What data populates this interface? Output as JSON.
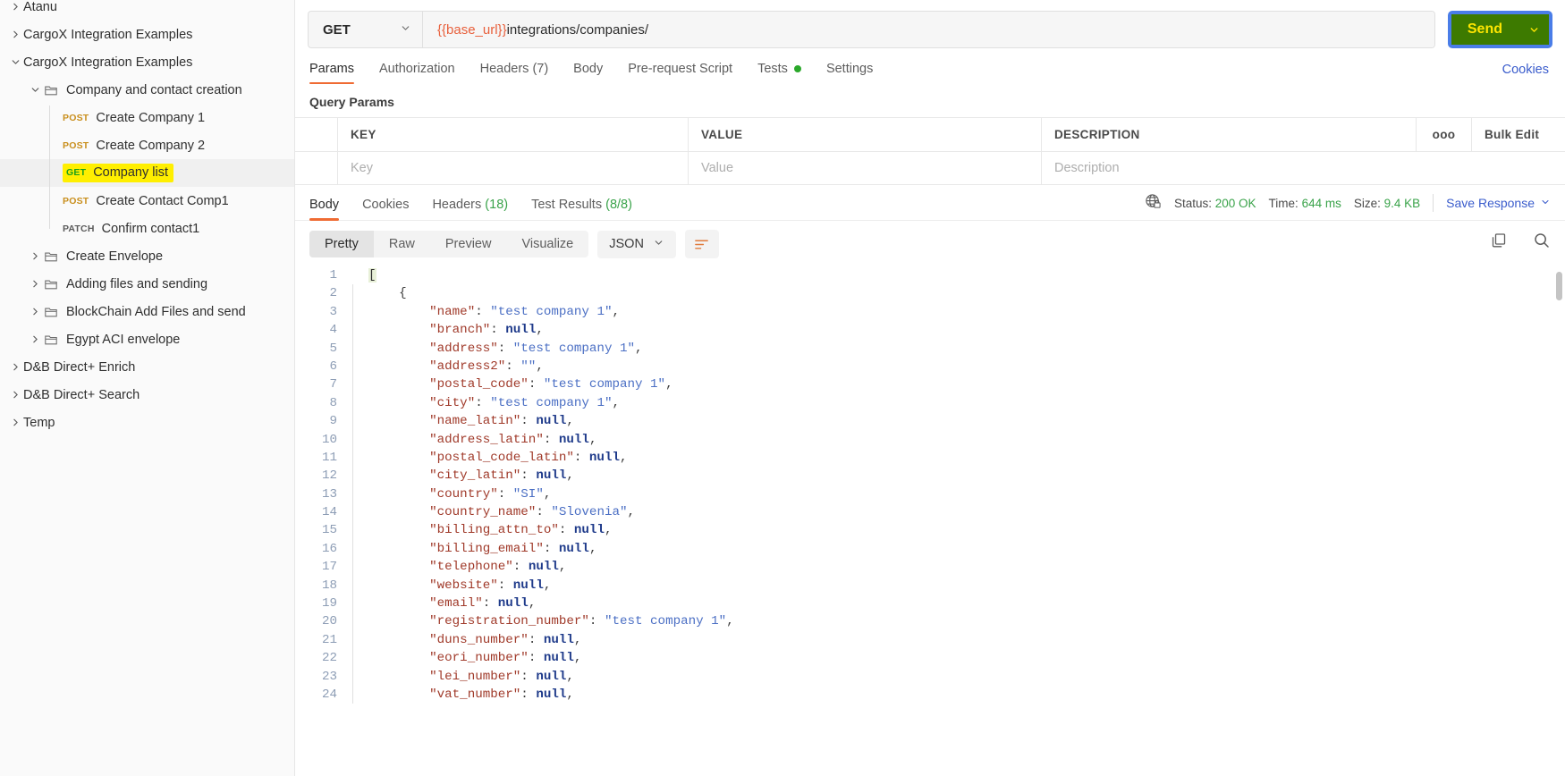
{
  "sidebar": {
    "items": [
      {
        "caret": "right",
        "indent": 0,
        "icon": "none",
        "label": "Atanu",
        "clipped": true
      },
      {
        "caret": "right",
        "indent": 0,
        "icon": "none",
        "label": "CargoX Integration Examples"
      },
      {
        "caret": "down",
        "indent": 0,
        "icon": "none",
        "label": "CargoX Integration Examples"
      },
      {
        "caret": "down",
        "indent": 1,
        "icon": "folder",
        "label": "Company and contact creation"
      },
      {
        "caret": "none",
        "indent": 2,
        "method": "POST",
        "label": "Create Company 1"
      },
      {
        "caret": "none",
        "indent": 2,
        "method": "POST",
        "label": "Create Company 2"
      },
      {
        "caret": "none",
        "indent": 2,
        "method": "GET",
        "label": "Company list",
        "selected": true,
        "highlight": true
      },
      {
        "caret": "none",
        "indent": 2,
        "method": "POST",
        "label": "Create Contact Comp1"
      },
      {
        "caret": "none",
        "indent": 2,
        "method": "PATCH",
        "label": "Confirm contact1"
      },
      {
        "caret": "right",
        "indent": 1,
        "icon": "folder",
        "label": "Create Envelope"
      },
      {
        "caret": "right",
        "indent": 1,
        "icon": "folder",
        "label": "Adding files and sending"
      },
      {
        "caret": "right",
        "indent": 1,
        "icon": "folder",
        "label": "BlockChain Add Files and send"
      },
      {
        "caret": "right",
        "indent": 1,
        "icon": "folder",
        "label": "Egypt ACI envelope"
      },
      {
        "caret": "right",
        "indent": 0,
        "icon": "none",
        "label": "D&B Direct+ Enrich"
      },
      {
        "caret": "right",
        "indent": 0,
        "icon": "none",
        "label": "D&B Direct+ Search"
      },
      {
        "caret": "right",
        "indent": 0,
        "icon": "none",
        "label": "Temp"
      }
    ]
  },
  "request": {
    "method": "GET",
    "url_variable": "{{base_url}}",
    "url_path": "integrations/companies/",
    "send_label": "Send",
    "cookies_label": "Cookies",
    "tabs": [
      {
        "label": "Params",
        "active": true
      },
      {
        "label": "Authorization",
        "active": false
      },
      {
        "label": "Headers (7)",
        "active": false
      },
      {
        "label": "Body",
        "active": false
      },
      {
        "label": "Pre-request Script",
        "active": false
      },
      {
        "label": "Tests",
        "active": false,
        "dot": true
      },
      {
        "label": "Settings",
        "active": false
      }
    ]
  },
  "query_params": {
    "title": "Query Params",
    "headers": [
      "KEY",
      "VALUE",
      "DESCRIPTION"
    ],
    "dots_label": "ooo",
    "bulk_edit_label": "Bulk Edit",
    "row_placeholders": [
      "Key",
      "Value",
      "Description"
    ]
  },
  "response": {
    "tabs": [
      {
        "label": "Body",
        "count": "",
        "active": true
      },
      {
        "label": "Cookies",
        "count": "",
        "active": false
      },
      {
        "label": "Headers",
        "count": "(18)",
        "active": false
      },
      {
        "label": "Test Results",
        "count": "(8/8)",
        "active": false
      }
    ],
    "status_label": "Status:",
    "status_value": "200 OK",
    "time_label": "Time:",
    "time_value": "644 ms",
    "size_label": "Size:",
    "size_value": "9.4 KB",
    "save_response_label": "Save Response",
    "view_modes": [
      {
        "label": "Pretty",
        "active": true
      },
      {
        "label": "Raw",
        "active": false
      },
      {
        "label": "Preview",
        "active": false
      },
      {
        "label": "Visualize",
        "active": false
      }
    ],
    "format": "JSON"
  },
  "body": {
    "lines": [
      {
        "n": 1,
        "indent": 0,
        "tokens": [
          {
            "t": "[",
            "c": "brk"
          }
        ]
      },
      {
        "n": 2,
        "indent": 1,
        "tokens": [
          {
            "t": "{",
            "c": "p"
          }
        ]
      },
      {
        "n": 3,
        "indent": 2,
        "tokens": [
          {
            "t": "\"name\"",
            "c": "k"
          },
          {
            "t": ": ",
            "c": "p"
          },
          {
            "t": "\"test company 1\"",
            "c": "s"
          },
          {
            "t": ",",
            "c": "p"
          }
        ]
      },
      {
        "n": 4,
        "indent": 2,
        "tokens": [
          {
            "t": "\"branch\"",
            "c": "k"
          },
          {
            "t": ": ",
            "c": "p"
          },
          {
            "t": "null",
            "c": "n"
          },
          {
            "t": ",",
            "c": "p"
          }
        ]
      },
      {
        "n": 5,
        "indent": 2,
        "tokens": [
          {
            "t": "\"address\"",
            "c": "k"
          },
          {
            "t": ": ",
            "c": "p"
          },
          {
            "t": "\"test company 1\"",
            "c": "s"
          },
          {
            "t": ",",
            "c": "p"
          }
        ]
      },
      {
        "n": 6,
        "indent": 2,
        "tokens": [
          {
            "t": "\"address2\"",
            "c": "k"
          },
          {
            "t": ": ",
            "c": "p"
          },
          {
            "t": "\"\"",
            "c": "s"
          },
          {
            "t": ",",
            "c": "p"
          }
        ]
      },
      {
        "n": 7,
        "indent": 2,
        "tokens": [
          {
            "t": "\"postal_code\"",
            "c": "k"
          },
          {
            "t": ": ",
            "c": "p"
          },
          {
            "t": "\"test company 1\"",
            "c": "s"
          },
          {
            "t": ",",
            "c": "p"
          }
        ]
      },
      {
        "n": 8,
        "indent": 2,
        "tokens": [
          {
            "t": "\"city\"",
            "c": "k"
          },
          {
            "t": ": ",
            "c": "p"
          },
          {
            "t": "\"test company 1\"",
            "c": "s"
          },
          {
            "t": ",",
            "c": "p"
          }
        ]
      },
      {
        "n": 9,
        "indent": 2,
        "tokens": [
          {
            "t": "\"name_latin\"",
            "c": "k"
          },
          {
            "t": ": ",
            "c": "p"
          },
          {
            "t": "null",
            "c": "n"
          },
          {
            "t": ",",
            "c": "p"
          }
        ]
      },
      {
        "n": 10,
        "indent": 2,
        "tokens": [
          {
            "t": "\"address_latin\"",
            "c": "k"
          },
          {
            "t": ": ",
            "c": "p"
          },
          {
            "t": "null",
            "c": "n"
          },
          {
            "t": ",",
            "c": "p"
          }
        ]
      },
      {
        "n": 11,
        "indent": 2,
        "tokens": [
          {
            "t": "\"postal_code_latin\"",
            "c": "k"
          },
          {
            "t": ": ",
            "c": "p"
          },
          {
            "t": "null",
            "c": "n"
          },
          {
            "t": ",",
            "c": "p"
          }
        ]
      },
      {
        "n": 12,
        "indent": 2,
        "tokens": [
          {
            "t": "\"city_latin\"",
            "c": "k"
          },
          {
            "t": ": ",
            "c": "p"
          },
          {
            "t": "null",
            "c": "n"
          },
          {
            "t": ",",
            "c": "p"
          }
        ]
      },
      {
        "n": 13,
        "indent": 2,
        "tokens": [
          {
            "t": "\"country\"",
            "c": "k"
          },
          {
            "t": ": ",
            "c": "p"
          },
          {
            "t": "\"SI\"",
            "c": "s"
          },
          {
            "t": ",",
            "c": "p"
          }
        ]
      },
      {
        "n": 14,
        "indent": 2,
        "tokens": [
          {
            "t": "\"country_name\"",
            "c": "k"
          },
          {
            "t": ": ",
            "c": "p"
          },
          {
            "t": "\"Slovenia\"",
            "c": "s"
          },
          {
            "t": ",",
            "c": "p"
          }
        ]
      },
      {
        "n": 15,
        "indent": 2,
        "tokens": [
          {
            "t": "\"billing_attn_to\"",
            "c": "k"
          },
          {
            "t": ": ",
            "c": "p"
          },
          {
            "t": "null",
            "c": "n"
          },
          {
            "t": ",",
            "c": "p"
          }
        ]
      },
      {
        "n": 16,
        "indent": 2,
        "tokens": [
          {
            "t": "\"billing_email\"",
            "c": "k"
          },
          {
            "t": ": ",
            "c": "p"
          },
          {
            "t": "null",
            "c": "n"
          },
          {
            "t": ",",
            "c": "p"
          }
        ]
      },
      {
        "n": 17,
        "indent": 2,
        "tokens": [
          {
            "t": "\"telephone\"",
            "c": "k"
          },
          {
            "t": ": ",
            "c": "p"
          },
          {
            "t": "null",
            "c": "n"
          },
          {
            "t": ",",
            "c": "p"
          }
        ]
      },
      {
        "n": 18,
        "indent": 2,
        "tokens": [
          {
            "t": "\"website\"",
            "c": "k"
          },
          {
            "t": ": ",
            "c": "p"
          },
          {
            "t": "null",
            "c": "n"
          },
          {
            "t": ",",
            "c": "p"
          }
        ]
      },
      {
        "n": 19,
        "indent": 2,
        "tokens": [
          {
            "t": "\"email\"",
            "c": "k"
          },
          {
            "t": ": ",
            "c": "p"
          },
          {
            "t": "null",
            "c": "n"
          },
          {
            "t": ",",
            "c": "p"
          }
        ]
      },
      {
        "n": 20,
        "indent": 2,
        "tokens": [
          {
            "t": "\"registration_number\"",
            "c": "k"
          },
          {
            "t": ": ",
            "c": "p"
          },
          {
            "t": "\"test company 1\"",
            "c": "s"
          },
          {
            "t": ",",
            "c": "p"
          }
        ]
      },
      {
        "n": 21,
        "indent": 2,
        "tokens": [
          {
            "t": "\"duns_number\"",
            "c": "k"
          },
          {
            "t": ": ",
            "c": "p"
          },
          {
            "t": "null",
            "c": "n"
          },
          {
            "t": ",",
            "c": "p"
          }
        ]
      },
      {
        "n": 22,
        "indent": 2,
        "tokens": [
          {
            "t": "\"eori_number\"",
            "c": "k"
          },
          {
            "t": ": ",
            "c": "p"
          },
          {
            "t": "null",
            "c": "n"
          },
          {
            "t": ",",
            "c": "p"
          }
        ]
      },
      {
        "n": 23,
        "indent": 2,
        "tokens": [
          {
            "t": "\"lei_number\"",
            "c": "k"
          },
          {
            "t": ": ",
            "c": "p"
          },
          {
            "t": "null",
            "c": "n"
          },
          {
            "t": ",",
            "c": "p"
          }
        ]
      },
      {
        "n": 24,
        "indent": 2,
        "tokens": [
          {
            "t": "\"vat_number\"",
            "c": "k"
          },
          {
            "t": ": ",
            "c": "p"
          },
          {
            "t": "null",
            "c": "n"
          },
          {
            "t": ",",
            "c": "p"
          }
        ]
      }
    ]
  }
}
